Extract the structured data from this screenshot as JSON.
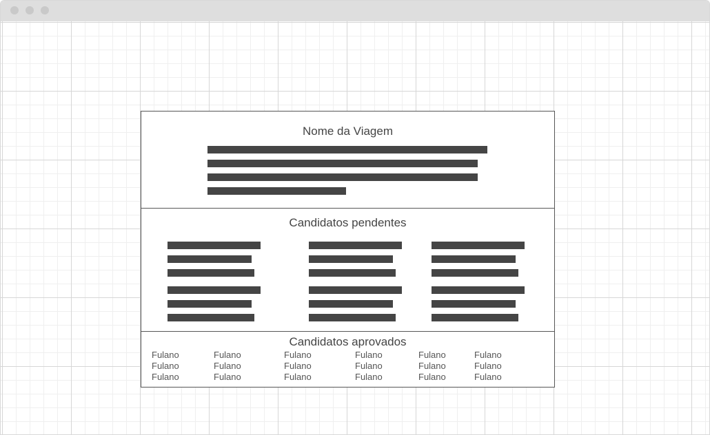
{
  "trip": {
    "title": "Nome da Viagem"
  },
  "pending": {
    "title": "Candidatos pendentes"
  },
  "approved": {
    "title": "Candidatos aprovados",
    "names": [
      [
        "Fulano",
        "Fulano",
        "Fulano",
        "Fulano",
        "Fulano",
        "Fulano"
      ],
      [
        "Fulano",
        "Fulano",
        "Fulano",
        "Fulano",
        "Fulano",
        "Fulano"
      ],
      [
        "Fulano",
        "Fulano",
        "Fulano",
        "Fulano",
        "Fulano",
        "Fulano"
      ]
    ]
  },
  "colors": {
    "border": "#555555",
    "bar": "#454545",
    "text": "#444444",
    "titlebar": "#dedede"
  }
}
